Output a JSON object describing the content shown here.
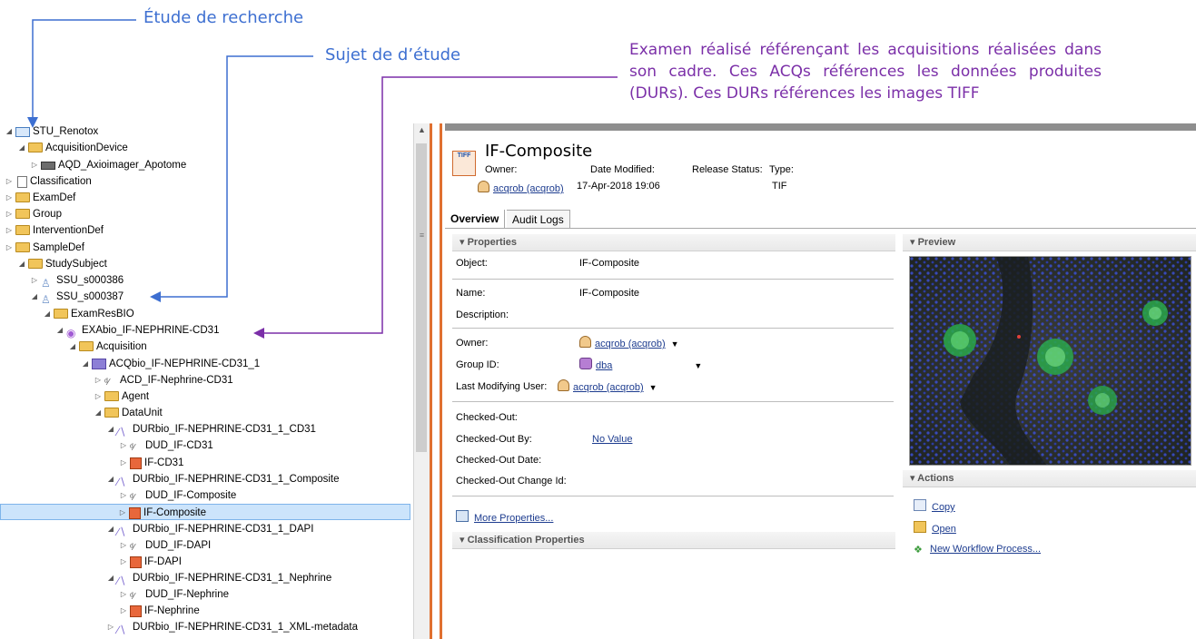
{
  "annotations": {
    "study": "Étude de recherche",
    "subject": "Sujet de d’étude",
    "exam": "Examen réalisé référençant les acquisitions réalisées dans son cadre. Ces ACQs références les données produites (DURs). Ces DURs références les images TIFF"
  },
  "tree": [
    {
      "label": "STU_Renotox",
      "twisty": "◢",
      "icon": "folder-blue-icon"
    },
    {
      "label": "AcquisitionDevice",
      "twisty": "◢",
      "icon": "folder-icon"
    },
    {
      "label": "AQD_Axioimager_Apotome",
      "twisty": "▷",
      "icon": "device-icon"
    },
    {
      "label": "Classification",
      "twisty": "▷",
      "icon": "document-icon"
    },
    {
      "label": "ExamDef",
      "twisty": "▷",
      "icon": "folder-icon"
    },
    {
      "label": "Group",
      "twisty": "▷",
      "icon": "folder-icon"
    },
    {
      "label": "InterventionDef",
      "twisty": "▷",
      "icon": "folder-icon"
    },
    {
      "label": "SampleDef",
      "twisty": "▷",
      "icon": "folder-icon"
    },
    {
      "label": "StudySubject",
      "twisty": "◢",
      "icon": "folder-icon"
    },
    {
      "label": "SSU_s000386",
      "twisty": "▷",
      "icon": "subject-icon"
    },
    {
      "label": "SSU_s000387",
      "twisty": "◢",
      "icon": "subject-icon"
    },
    {
      "label": "ExamResBIO",
      "twisty": "◢",
      "icon": "folder-icon"
    },
    {
      "label": "EXAbio_IF-NEPHRINE-CD31",
      "twisty": "◢",
      "icon": "exam-icon"
    },
    {
      "label": "Acquisition",
      "twisty": "◢",
      "icon": "folder-icon"
    },
    {
      "label": "ACQbio_IF-NEPHRINE-CD31_1",
      "twisty": "◢",
      "icon": "acquisition-icon"
    },
    {
      "label": "ACD_IF-Nephrine-CD31",
      "twisty": "▷",
      "icon": "dud-icon"
    },
    {
      "label": "Agent",
      "twisty": "▷",
      "icon": "folder-icon"
    },
    {
      "label": "DataUnit",
      "twisty": "◢",
      "icon": "folder-icon"
    },
    {
      "label": "DURbio_IF-NEPHRINE-CD31_1_CD31",
      "twisty": "◢",
      "icon": "dur-icon"
    },
    {
      "label": "DUD_IF-CD31",
      "twisty": "▷",
      "icon": "dud-icon"
    },
    {
      "label": "IF-CD31",
      "twisty": "▷",
      "icon": "tiff-icon"
    },
    {
      "label": "DURbio_IF-NEPHRINE-CD31_1_Composite",
      "twisty": "◢",
      "icon": "dur-icon"
    },
    {
      "label": "DUD_IF-Composite",
      "twisty": "▷",
      "icon": "dud-icon"
    },
    {
      "label": "IF-Composite",
      "twisty": "▷",
      "icon": "tiff-icon"
    },
    {
      "label": "DURbio_IF-NEPHRINE-CD31_1_DAPI",
      "twisty": "◢",
      "icon": "dur-icon"
    },
    {
      "label": "DUD_IF-DAPI",
      "twisty": "▷",
      "icon": "dud-icon"
    },
    {
      "label": "IF-DAPI",
      "twisty": "▷",
      "icon": "tiff-icon"
    },
    {
      "label": "DURbio_IF-NEPHRINE-CD31_1_Nephrine",
      "twisty": "◢",
      "icon": "dur-icon"
    },
    {
      "label": "DUD_IF-Nephrine",
      "twisty": "▷",
      "icon": "dud-icon"
    },
    {
      "label": "IF-Nephrine",
      "twisty": "▷",
      "icon": "tiff-icon"
    },
    {
      "label": "DURbio_IF-NEPHRINE-CD31_1_XML-metadata",
      "twisty": "▷",
      "icon": "dur-icon"
    }
  ],
  "editor": {
    "title": "IF-Composite",
    "badge": "TIFF",
    "owner_label": "Owner:",
    "owner_value": "acqrob (acqrob)",
    "date_label": "Date Modified:",
    "date_value": "17-Apr-2018 19:06",
    "release_label": "Release Status:",
    "type_label": "Type:",
    "type_value": "TIF"
  },
  "tabs": {
    "overview": "Overview",
    "audit": "Audit Logs"
  },
  "properties": {
    "header": "Properties",
    "object_label": "Object:",
    "object_value": "IF-Composite",
    "name_label": "Name:",
    "name_value": "IF-Composite",
    "description_label": "Description:",
    "owner_label": "Owner:",
    "owner_value": "acqrob (acqrob)",
    "group_label": "Group ID:",
    "group_value": "dba",
    "lmu_label": "Last Modifying User:",
    "lmu_value": "acqrob (acqrob)",
    "checked_out_label": "Checked-Out:",
    "checked_out_by_label": "Checked-Out By:",
    "checked_out_by_value": "No Value",
    "checked_out_date_label": "Checked-Out Date:",
    "checked_out_change_label": "Checked-Out Change Id:",
    "more": "More Properties..."
  },
  "classification": {
    "header": "Classification Properties"
  },
  "preview": {
    "header": "Preview"
  },
  "actions": {
    "header": "Actions",
    "copy": "Copy",
    "open": "Open",
    "workflow": "New Workflow Process..."
  },
  "colors": {
    "annotation_blue": "#3d6fd1",
    "annotation_purple": "#7b2fa8",
    "divider": "#e07030",
    "selection": "#cce4fb"
  }
}
